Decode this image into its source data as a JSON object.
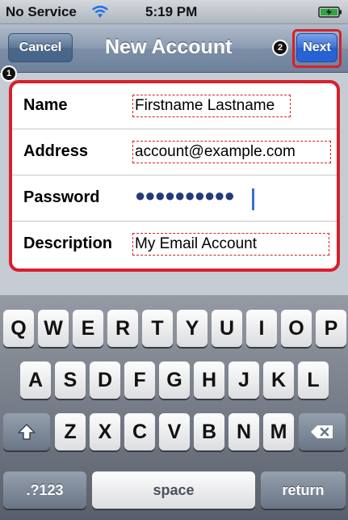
{
  "status_bar": {
    "carrier": "No Service",
    "time": "5:19 PM",
    "icons": [
      "wifi-icon",
      "battery-icon"
    ]
  },
  "nav": {
    "title": "New Account",
    "cancel_label": "Cancel",
    "next_label": "Next"
  },
  "callouts": {
    "first": "1",
    "second": "2"
  },
  "form": {
    "rows": [
      {
        "label": "Name",
        "value": "Firstname Lastname"
      },
      {
        "label": "Address",
        "value": "account@example.com"
      },
      {
        "label": "Password",
        "value": "●●●●●●●●●●"
      },
      {
        "label": "Description",
        "value": "My Email Account"
      }
    ]
  },
  "keyboard": {
    "row1": [
      "Q",
      "W",
      "E",
      "R",
      "T",
      "Y",
      "U",
      "I",
      "O",
      "P"
    ],
    "row2": [
      "A",
      "S",
      "D",
      "F",
      "G",
      "H",
      "J",
      "K",
      "L"
    ],
    "row3": [
      "Z",
      "X",
      "C",
      "V",
      "B",
      "N",
      "M"
    ],
    "numbers_label": ".?123",
    "space_label": "space",
    "return_label": "return",
    "shift_icon": "shift-icon",
    "delete_icon": "delete-icon"
  },
  "colors": {
    "highlight_red": "#d8202a",
    "next_blue": "#2a63d6",
    "nav_blue": "#6d819b"
  }
}
